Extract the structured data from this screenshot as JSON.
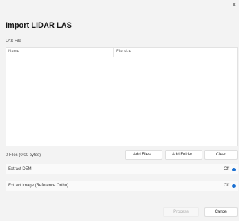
{
  "window": {
    "close_glyph": "x"
  },
  "dialog": {
    "title": "Import LIDAR LAS",
    "section_label": "LAS File",
    "table": {
      "columns": [
        "Name",
        "File size"
      ],
      "rows": []
    },
    "files_summary": "0 Files (0.00 bytes)",
    "buttons": {
      "add_files": "Add Files...",
      "add_folder": "Add Folder...",
      "clear": "Clear",
      "process": "Process",
      "cancel": "Cancel"
    },
    "options": [
      {
        "label": "Extract DEM",
        "state": "Off"
      },
      {
        "label": "Extract Image (Reference Ortho)",
        "state": "Off"
      }
    ]
  },
  "colors": {
    "accent": "#1a6fd1",
    "background": "#f3f3f3"
  }
}
